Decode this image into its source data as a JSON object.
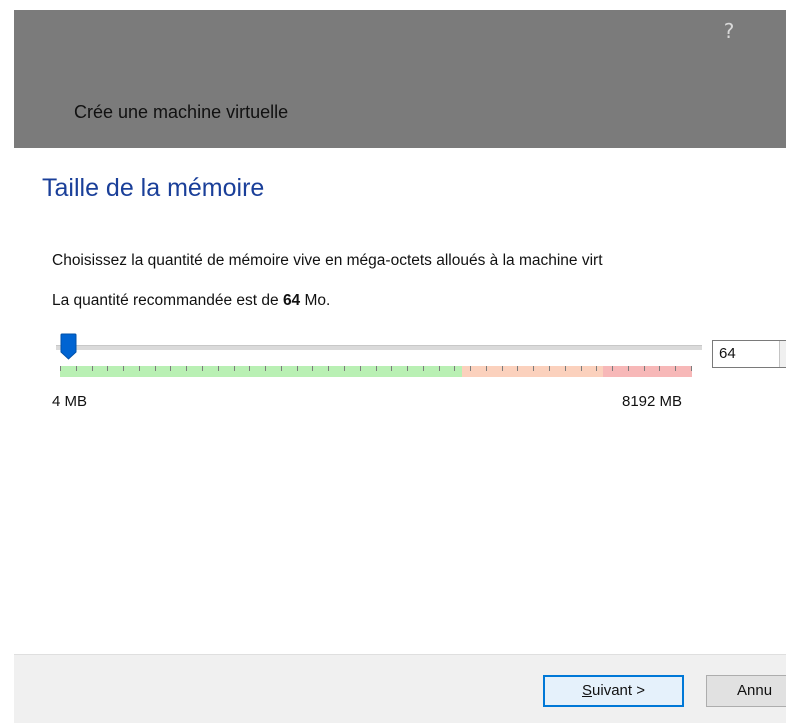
{
  "header": {
    "help_symbol": "?",
    "title": "Crée une machine virtuelle"
  },
  "page": {
    "title": "Taille de la mémoire",
    "description": "Choisissez la quantité de mémoire vive en méga-octets alloués à la machine virt",
    "recommend_prefix": "La quantité recommandée est de ",
    "recommend_value": "64",
    "recommend_suffix": " Mo."
  },
  "memory_slider": {
    "value_mb": 64,
    "min_label": "4 MB",
    "max_label": "8192 MB",
    "min_mb": 4,
    "max_mb": 8192
  },
  "spinbox": {
    "value": "64"
  },
  "footer": {
    "next_label_mnemonic": "S",
    "next_label_rest": "uivant >",
    "cancel_label": "Annu"
  },
  "colors": {
    "header_bg": "#7b7b7b",
    "title_blue": "#1a3f99",
    "range_green": "#b9f0b4",
    "range_orange": "#fbd1bd",
    "range_red": "#f7b8b8",
    "thumb_blue": "#0064d2",
    "focus_blue": "#0078d7"
  }
}
